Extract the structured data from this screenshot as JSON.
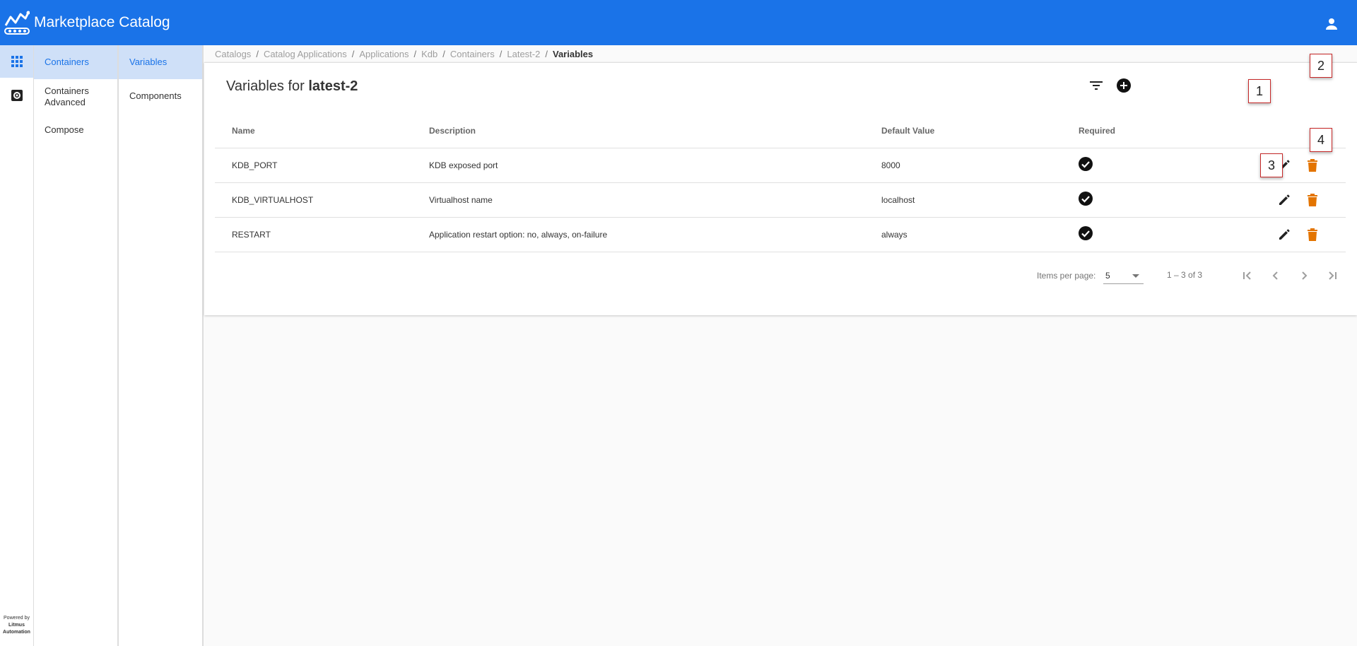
{
  "app": {
    "title": "Marketplace Catalog"
  },
  "rail": {
    "powered_by": "Powered by",
    "brand_line1": "Litmus",
    "brand_line2": "Automation"
  },
  "nav1": {
    "items": [
      {
        "label": "Containers",
        "active": true
      },
      {
        "label": "Containers Advanced",
        "active": false
      },
      {
        "label": "Compose",
        "active": false
      }
    ]
  },
  "nav2": {
    "items": [
      {
        "label": "Variables",
        "active": true
      },
      {
        "label": "Components",
        "active": false
      }
    ]
  },
  "breadcrumb": {
    "items": [
      "Catalogs",
      "Catalog Applications",
      "Applications",
      "Kdb",
      "Containers",
      "Latest-2"
    ],
    "current": "Variables",
    "separator": "/"
  },
  "page": {
    "title_prefix": "Variables for",
    "title_name": "latest-2"
  },
  "table": {
    "columns": [
      "Name",
      "Description",
      "Default Value",
      "Required"
    ],
    "rows": [
      {
        "name": "KDB_PORT",
        "description": "KDB exposed port",
        "default": "8000",
        "required": true
      },
      {
        "name": "KDB_VIRTUALHOST",
        "description": "Virtualhost name",
        "default": "localhost",
        "required": true
      },
      {
        "name": "RESTART",
        "description": "Application restart option: no, always, on-failure",
        "default": "always",
        "required": true
      }
    ]
  },
  "paginator": {
    "items_per_page_label": "Items per page:",
    "page_size": "5",
    "range": "1 – 3 of 3"
  },
  "callouts": [
    "1",
    "2",
    "3",
    "4"
  ],
  "colors": {
    "topbar": "#1a73e8",
    "active_nav": "#cfe0f8",
    "delete": "#e37400",
    "callout_border": "#c62828"
  }
}
